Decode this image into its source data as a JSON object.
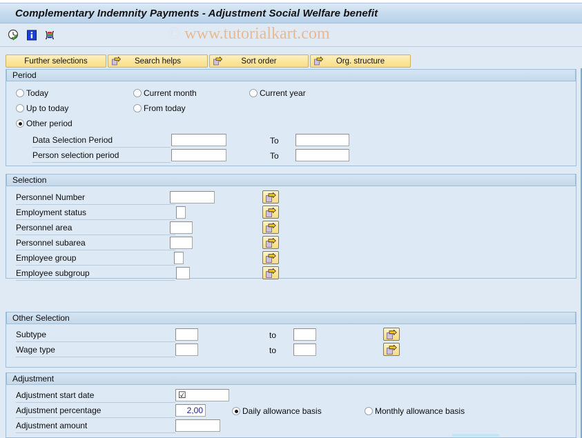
{
  "window": {
    "title": "Complementary Indemnity Payments - Adjustment Social Welfare benefit"
  },
  "watermark": {
    "copyright": "©",
    "text": " www.tutorialkart.com"
  },
  "toolbar": {
    "icons": [
      {
        "name": "execute-clock-icon",
        "title": "Execute"
      },
      {
        "name": "information-icon",
        "title": "Information"
      },
      {
        "name": "variant-icon",
        "title": "Get Variant"
      }
    ]
  },
  "buttonbar": {
    "buttons": [
      {
        "label": "Further selections",
        "icon": null
      },
      {
        "label": "Search helps",
        "icon": "arrow-right-icon"
      },
      {
        "label": "Sort order",
        "icon": "arrow-right-icon"
      },
      {
        "label": "Org. structure",
        "icon": "arrow-right-icon"
      }
    ]
  },
  "period": {
    "title": "Period",
    "radios": [
      {
        "label": "Today",
        "checked": false
      },
      {
        "label": "Current month",
        "checked": false
      },
      {
        "label": "Current year",
        "checked": false
      },
      {
        "label": "Up to today",
        "checked": false
      },
      {
        "label": "From today",
        "checked": false
      },
      {
        "label": "Other period",
        "checked": true
      }
    ],
    "rows": [
      {
        "label": "Data Selection Period",
        "value": "",
        "to_label": "To",
        "to_value": ""
      },
      {
        "label": "Person selection period",
        "value": "",
        "to_label": "To",
        "to_value": ""
      }
    ]
  },
  "selection": {
    "title": "Selection",
    "rows": [
      {
        "label": "Personnel Number",
        "value": ""
      },
      {
        "label": "Employment status",
        "value": ""
      },
      {
        "label": "Personnel area",
        "value": ""
      },
      {
        "label": "Personnel subarea",
        "value": ""
      },
      {
        "label": "Employee group",
        "value": ""
      },
      {
        "label": "Employee subgroup",
        "value": ""
      }
    ]
  },
  "other_selection": {
    "title": "Other Selection",
    "rows": [
      {
        "label": "Subtype",
        "value": "",
        "to_label": "to",
        "to_value": ""
      },
      {
        "label": "Wage type",
        "value": "",
        "to_label": "to",
        "to_value": ""
      }
    ]
  },
  "adjustment": {
    "title": "Adjustment",
    "rows": [
      {
        "label": "Adjustment start date",
        "value": ""
      },
      {
        "label": "Adjustment percentage",
        "value": "2,00"
      },
      {
        "label": "Adjustment amount",
        "value": ""
      }
    ],
    "basis_radios": [
      {
        "label": "Daily allowance basis",
        "checked": true
      },
      {
        "label": "Monthly allowance basis",
        "checked": false
      }
    ]
  },
  "colors": {
    "title_bar": "#c5daee",
    "canvas": "#dfeaf4",
    "group_bg": "#dde9f4",
    "group_border": "#9dbdd8",
    "button_yellow": "#fae79f",
    "watermark": "#eab88a",
    "input_text": "#22228a"
  }
}
